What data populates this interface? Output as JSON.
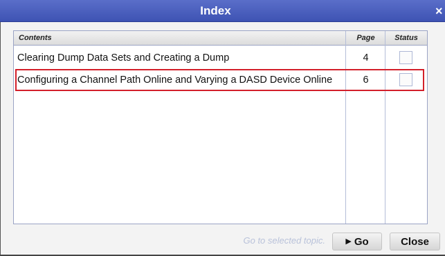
{
  "dialog": {
    "title": "Index",
    "close_glyph": "×"
  },
  "table": {
    "columns": {
      "contents": "Contents",
      "page": "Page",
      "status": "Status"
    },
    "rows": [
      {
        "contents": "Clearing Dump Data Sets and Creating a Dump",
        "page": "4",
        "status_checked": false
      },
      {
        "contents": "Configuring a Channel Path Online and Varying a DASD Device Online",
        "page": "6",
        "status_checked": false,
        "selected": true
      }
    ]
  },
  "footer": {
    "hint": "Go to selected topic.",
    "go_arrow": "▶",
    "go_label": "Go",
    "close_label": "Close"
  },
  "colors": {
    "title_bar": "#4a5fc1",
    "selection_outline": "#d31f2a",
    "panel_border": "#9aa3c4"
  }
}
